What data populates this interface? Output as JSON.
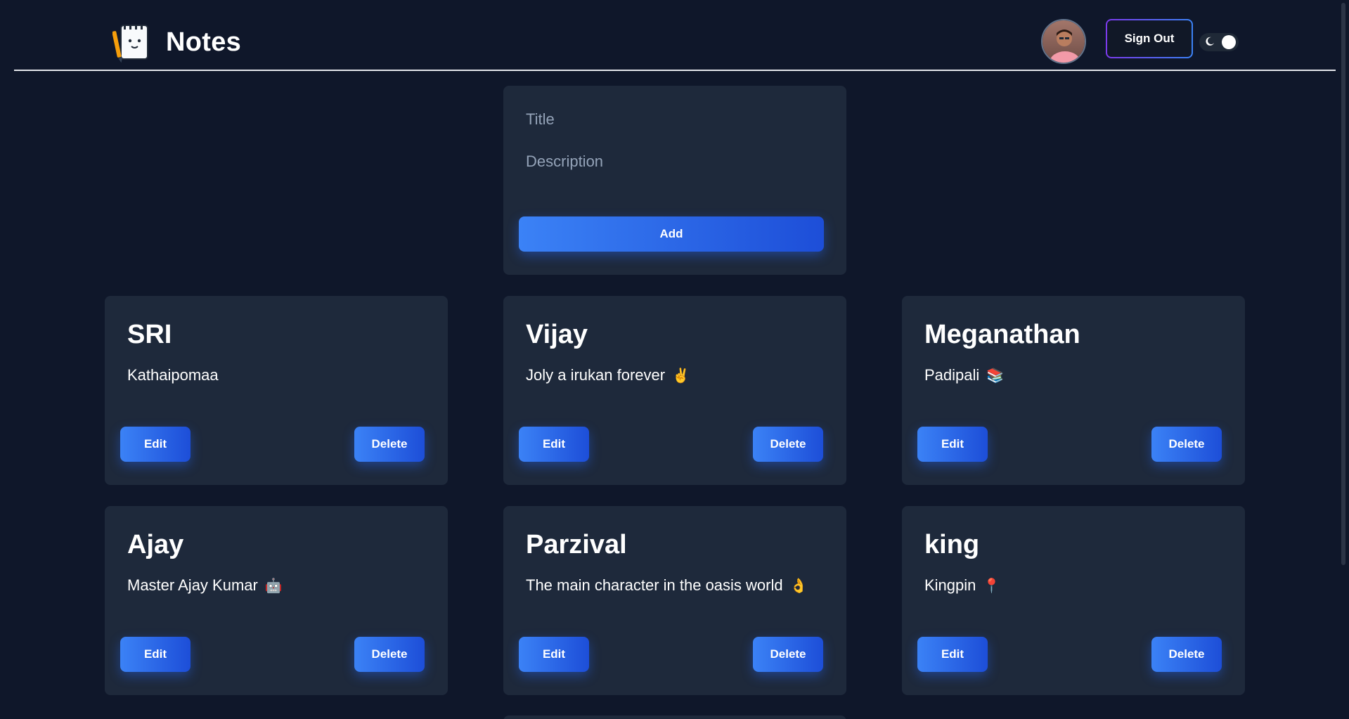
{
  "header": {
    "title": "Notes",
    "signout_label": "Sign Out",
    "logo_icon": "notepad-icon",
    "avatar_icon": "user-avatar",
    "theme_toggle_icon": "moon-icon"
  },
  "form": {
    "title_placeholder": "Title",
    "description_placeholder": "Description",
    "add_label": "Add"
  },
  "actions": {
    "edit_label": "Edit",
    "delete_label": "Delete"
  },
  "notes": [
    {
      "title": "SRI",
      "description": "Kathaipomaa",
      "emoji": ""
    },
    {
      "title": "Vijay",
      "description": "Joly a irukan forever",
      "emoji": "✌️"
    },
    {
      "title": "Meganathan",
      "description": "Padipali",
      "emoji": "📚"
    },
    {
      "title": "Ajay",
      "description": "Master Ajay Kumar",
      "emoji": "🤖"
    },
    {
      "title": "Parzival",
      "description": "The main character in the oasis world",
      "emoji": "👌"
    },
    {
      "title": "king",
      "description": "Kingpin",
      "emoji": "📍"
    }
  ],
  "colors": {
    "background": "#0f172a",
    "card": "#1e293b",
    "button_gradient_start": "#3b82f6",
    "button_gradient_end": "#1d4ed8",
    "signout_border_start": "#7c3aed",
    "signout_border_end": "#3b82f6"
  }
}
